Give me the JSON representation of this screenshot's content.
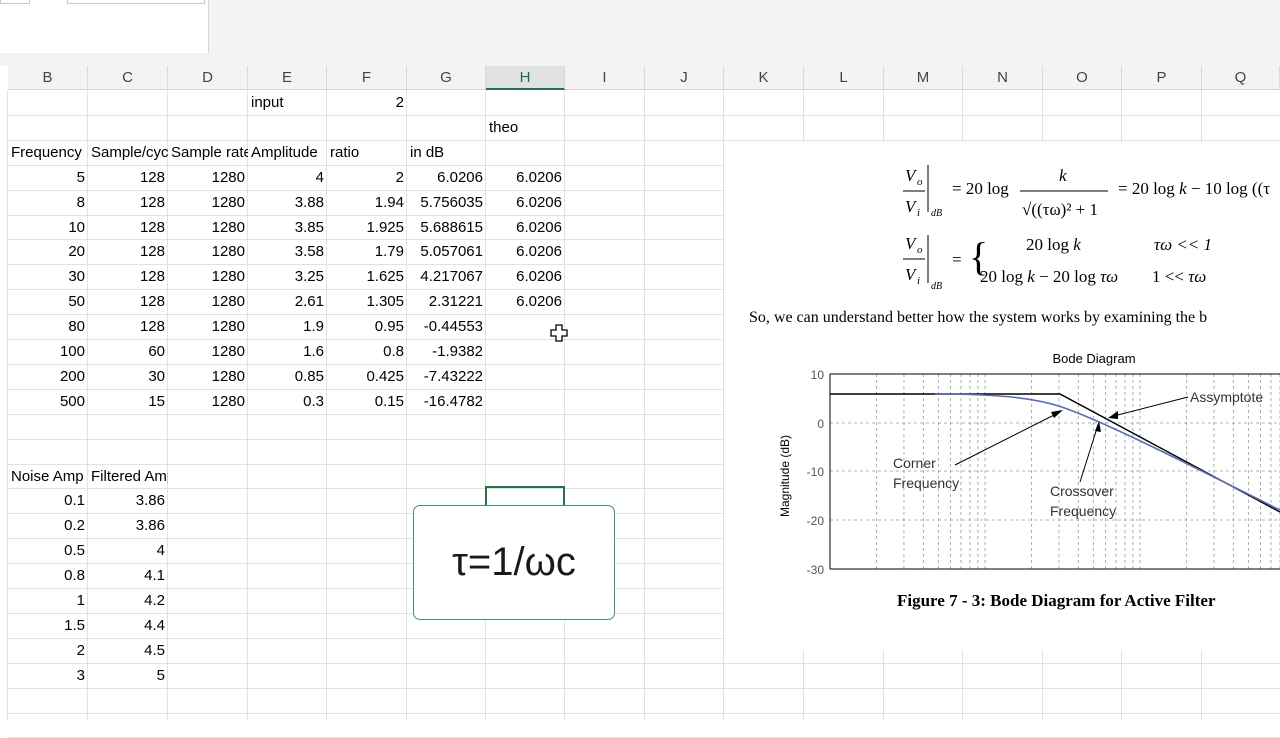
{
  "columns": [
    "B",
    "C",
    "D",
    "E",
    "F",
    "G",
    "H",
    "I",
    "J",
    "K",
    "L",
    "M",
    "N",
    "O",
    "P",
    "Q"
  ],
  "selected_column": "H",
  "cells": {
    "input_label": "input",
    "input_value": "2",
    "theo_label": "theo",
    "headers": [
      "Frequency",
      "Sample/cycle",
      "Sample rate",
      "Amplitude",
      "ratio",
      "in dB"
    ],
    "rows": [
      [
        "5",
        "128",
        "1280",
        "4",
        "2",
        "6.0206",
        "6.0206"
      ],
      [
        "8",
        "128",
        "1280",
        "3.88",
        "1.94",
        "5.756035",
        "6.0206"
      ],
      [
        "10",
        "128",
        "1280",
        "3.85",
        "1.925",
        "5.688615",
        "6.0206"
      ],
      [
        "20",
        "128",
        "1280",
        "3.58",
        "1.79",
        "5.057061",
        "6.0206"
      ],
      [
        "30",
        "128",
        "1280",
        "3.25",
        "1.625",
        "4.217067",
        "6.0206"
      ],
      [
        "50",
        "128",
        "1280",
        "2.61",
        "1.305",
        "2.31221",
        "6.0206"
      ],
      [
        "80",
        "128",
        "1280",
        "1.9",
        "0.95",
        "-0.44553",
        ""
      ],
      [
        "100",
        "60",
        "1280",
        "1.6",
        "0.8",
        "-1.9382",
        ""
      ],
      [
        "200",
        "30",
        "1280",
        "0.85",
        "0.425",
        "-7.43222",
        ""
      ],
      [
        "500",
        "15",
        "1280",
        "0.3",
        "0.15",
        "-16.4782",
        ""
      ]
    ],
    "noise_headers": [
      "Noise Amp",
      "Filtered Amp(V)"
    ],
    "noise_rows": [
      [
        "0.1",
        "3.86"
      ],
      [
        "0.2",
        "3.86"
      ],
      [
        "0.5",
        "4"
      ],
      [
        "0.8",
        "4.1"
      ],
      [
        "1",
        "4.2"
      ],
      [
        "1.5",
        "4.4"
      ],
      [
        "2",
        "4.5"
      ],
      [
        "3",
        "5"
      ]
    ]
  },
  "overlay_text": "τ=1/ωc",
  "doc": {
    "paragraph": "So, we can understand better how the system works by examining the b",
    "caption": "Figure 7 - 3: Bode Diagram for Active Filter",
    "bode": {
      "title": "Bode Diagram",
      "ylabel": "Magnitude (dB)",
      "yticks": [
        "10",
        "0",
        "-10",
        "-20",
        "-30"
      ],
      "annotations": [
        "Assymptote",
        "Corner",
        "Frequency",
        "Crossover",
        "Frequency"
      ]
    }
  },
  "colors": {
    "accent": "#217346",
    "overlay_border": "#3e8f7e",
    "curve": "#5b6bb5"
  }
}
